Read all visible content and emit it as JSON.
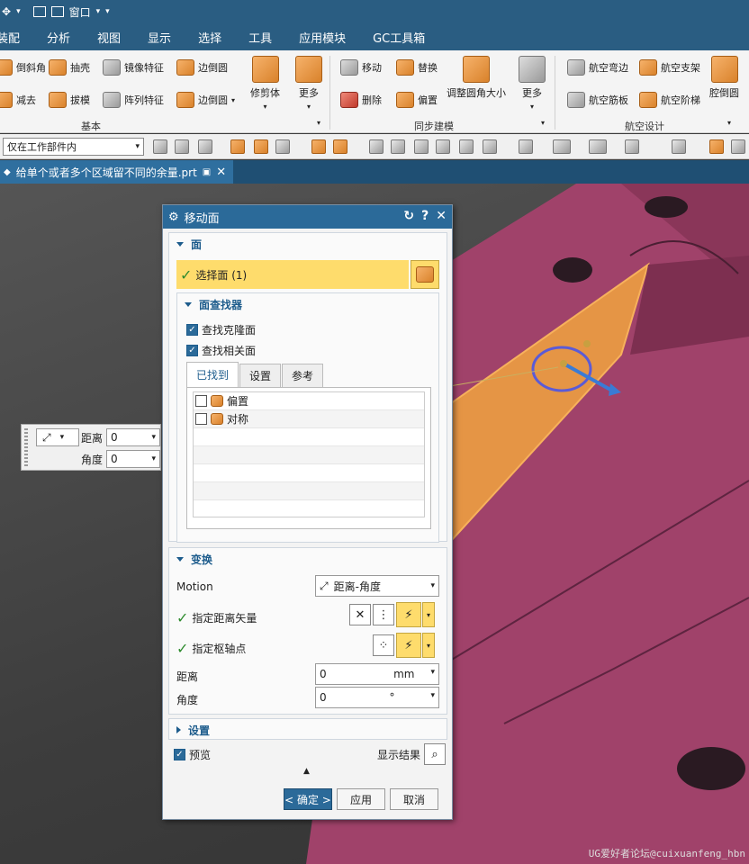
{
  "titlebar": {
    "window_label": "窗口"
  },
  "menubar": {
    "items": [
      "装配",
      "分析",
      "视图",
      "显示",
      "选择",
      "工具",
      "应用模块",
      "GC工具箱"
    ]
  },
  "ribbon": {
    "basic": {
      "items": [
        "倒斜角",
        "抽壳",
        "镜像特征",
        "边倒圆",
        "减去",
        "拔模",
        "阵列特征",
        "边倒圆"
      ],
      "trim_body": "修剪体",
      "more": "更多",
      "group_label": "基本"
    },
    "sync": {
      "items": [
        "移动",
        "替换",
        "删除",
        "偏置"
      ],
      "resize_blend": "调整圆角大小",
      "more": "更多",
      "group_label": "同步建模"
    },
    "aero": {
      "items": [
        "航空弯边",
        "航空支架",
        "航空筋板",
        "航空阶梯"
      ],
      "pocket_blend": "腔倒圆",
      "group_label": "航空设计"
    }
  },
  "toolbar2": {
    "scope": "仅在工作部件内"
  },
  "document": {
    "tab_title": "给单个或者多个区域留不同的余量.prt"
  },
  "mini_toolbar": {
    "distance_label": "距离",
    "distance_value": "0",
    "angle_label": "角度",
    "angle_value": "0"
  },
  "dialog": {
    "title": "移动面",
    "face_section": "面",
    "select_face": "选择面 (1)",
    "finder_section": "面查找器",
    "find_clone": "查找克隆面",
    "find_related": "查找相关面",
    "tabs": [
      "已找到",
      "设置",
      "参考"
    ],
    "found_items": [
      "偏置",
      "对称"
    ],
    "transform_section": "变换",
    "motion_label": "Motion",
    "motion_value": "距离-角度",
    "specify_vector": "指定距离矢量",
    "specify_pivot": "指定枢轴点",
    "distance_label": "距离",
    "distance_value": "0",
    "distance_unit": "mm",
    "angle_label": "角度",
    "angle_value": "0",
    "angle_unit": "°",
    "settings_section": "设置",
    "preview_label": "预览",
    "show_result": "显示结果",
    "ok": "< 确定 >",
    "apply": "应用",
    "cancel": "取消"
  },
  "watermark": "UG爱好者论坛@cuixuanfeng_hbn"
}
